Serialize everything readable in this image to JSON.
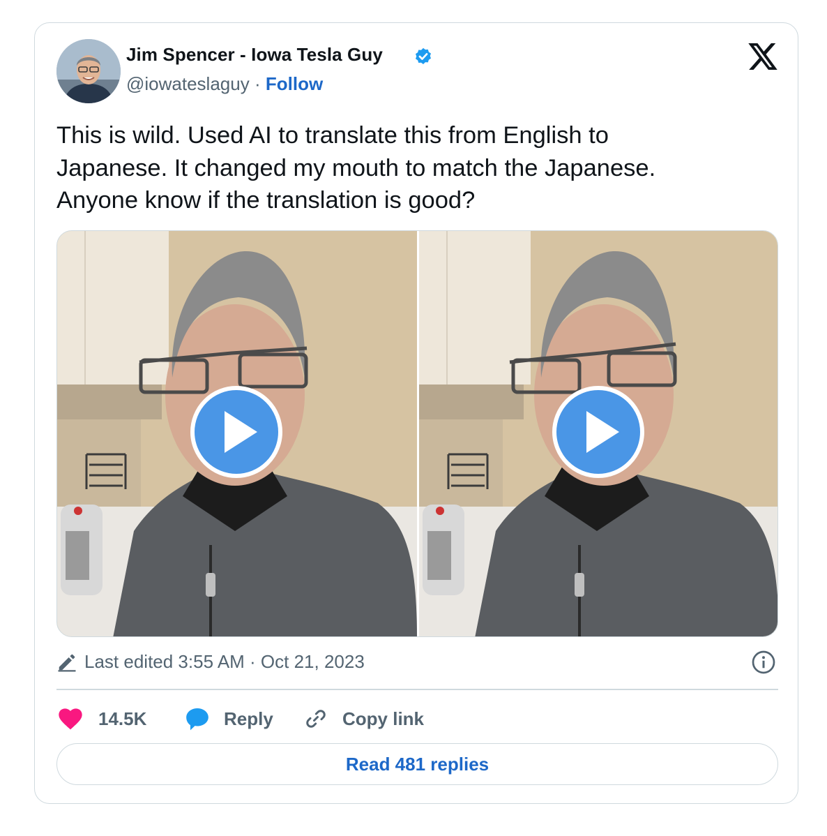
{
  "author": {
    "name": "Jim Spencer - Iowa Tesla Guy",
    "handle": "@iowateslaguy",
    "separator": "·",
    "follow_label": "Follow",
    "verified": true
  },
  "tweet": {
    "text": "This is wild. Used AI to translate this from English to\nJapanese. It changed my mouth to match the Japanese.\nAnyone know if the translation is good?"
  },
  "media": {
    "videos": [
      {
        "kind": "video",
        "play_icon": "play-icon"
      },
      {
        "kind": "video",
        "play_icon": "play-icon"
      }
    ]
  },
  "meta": {
    "edited_text": "Last edited 3:55 AM · Oct 21, 2023"
  },
  "actions": {
    "likes": "14.5K",
    "reply_label": "Reply",
    "copy_label": "Copy link"
  },
  "read_replies_label": "Read 481 replies",
  "colors": {
    "accent": "#1d68c8",
    "like": "#f91880",
    "reply_icon": "#1d9bf0",
    "play_button": "#4a96e6",
    "muted_text": "#536471",
    "border": "#cfd9de"
  }
}
